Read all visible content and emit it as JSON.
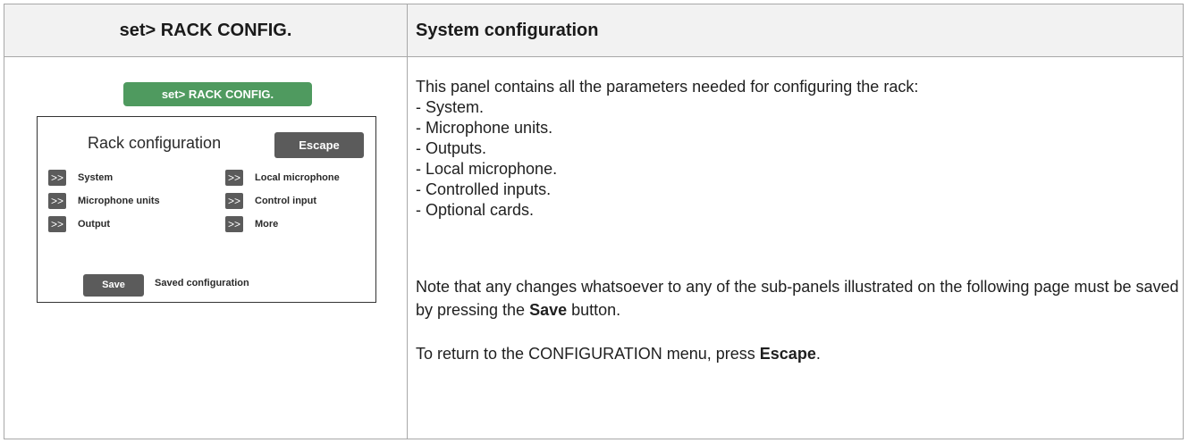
{
  "header": {
    "left_title": "set> RACK CONFIG.",
    "right_title": "System configuration"
  },
  "panel": {
    "green_title": "set> RACK CONFIG.",
    "screen_title": "Rack configuration",
    "escape_label": "Escape",
    "arrow_symbol": ">>",
    "left_items": [
      "System",
      "Microphone units",
      "Output"
    ],
    "right_items": [
      "Local microphone",
      "Control input",
      "More"
    ],
    "save_label": "Save",
    "saved_text": "Saved configuration"
  },
  "description": {
    "intro": "This panel contains all the parameters needed for configuring the rack:",
    "list": [
      "- System.",
      "- Microphone units.",
      "- Outputs.",
      "- Local microphone.",
      "- Controlled inputs.",
      "- Optional cards."
    ],
    "note_before": "Note that any changes whatsoever to any of the sub-panels illustrated on the following page must be saved by pressing the ",
    "note_bold": "Save",
    "note_after": " button.",
    "escape_before": "To return to the CONFIGURATION menu, press ",
    "escape_bold": "Escape",
    "escape_after": "."
  }
}
